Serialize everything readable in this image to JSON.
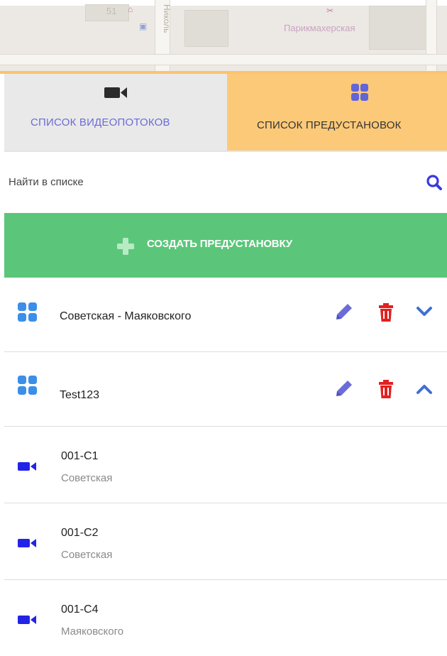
{
  "map": {
    "labels": {
      "house_number": "51",
      "street_name": "Николь",
      "poi_name": "Парикмахерская"
    }
  },
  "tabs": [
    {
      "label": "СПИСОК ВИДЕОПОТОКОВ",
      "icon": "video-camera-icon",
      "active": false
    },
    {
      "label": "СПИСОК ПРЕДУСТАНОВОК",
      "icon": "grid-icon",
      "active": true
    }
  ],
  "search": {
    "placeholder": "Найти в списке",
    "value": ""
  },
  "create_button": {
    "label": "СОЗДАТЬ ПРЕДУСТАНОВКУ",
    "icon": "plus-icon"
  },
  "presets": [
    {
      "name": "Советская - Маяковского",
      "expanded": false
    },
    {
      "name": "Test123",
      "expanded": true,
      "cameras": [
        {
          "name": "001-C1",
          "street": "Советская"
        },
        {
          "name": "001-C2",
          "street": "Советская"
        },
        {
          "name": "001-C4",
          "street": "Маяковского"
        }
      ]
    }
  ],
  "colors": {
    "accent_orange": "#fcc978",
    "create_green": "#5bc679",
    "icon_blue": "#3b8fe8",
    "camera_blue": "#2323e8",
    "edit_purple": "#6c6cd8",
    "delete_red": "#e32020",
    "chevron_blue": "#3d6fd6"
  }
}
